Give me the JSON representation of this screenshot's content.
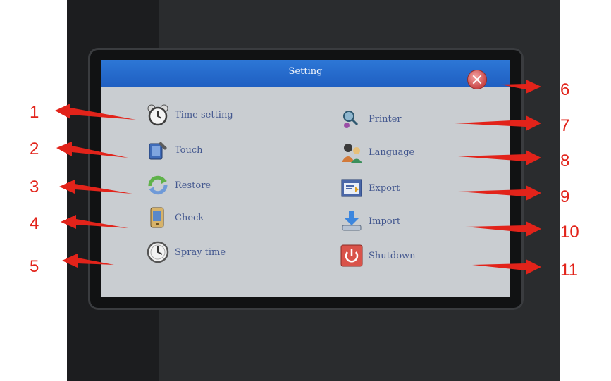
{
  "window": {
    "title": "Setting",
    "close_icon": "close-icon"
  },
  "left_menu": [
    {
      "label": "Time setting",
      "icon": "alarm-clock-icon"
    },
    {
      "label": "Touch",
      "icon": "touch-tablet-icon"
    },
    {
      "label": "Restore",
      "icon": "restore-arrows-icon"
    },
    {
      "label": "Check",
      "icon": "check-device-icon"
    },
    {
      "label": "Spray time",
      "icon": "clock-icon"
    }
  ],
  "right_menu": [
    {
      "label": "Printer",
      "icon": "printer-icon"
    },
    {
      "label": "Language",
      "icon": "language-people-icon"
    },
    {
      "label": "Export",
      "icon": "export-icon"
    },
    {
      "label": "Import",
      "icon": "import-download-icon"
    },
    {
      "label": "Shutdown",
      "icon": "power-icon"
    }
  ],
  "callouts": {
    "left": [
      "1",
      "2",
      "3",
      "4",
      "5"
    ],
    "right": [
      "6",
      "7",
      "8",
      "9",
      "10",
      "11"
    ]
  },
  "colors": {
    "titlebar": "#2566cc",
    "screen": "#c9cdd1",
    "label": "#44588f",
    "annotation": "#e2231a"
  }
}
